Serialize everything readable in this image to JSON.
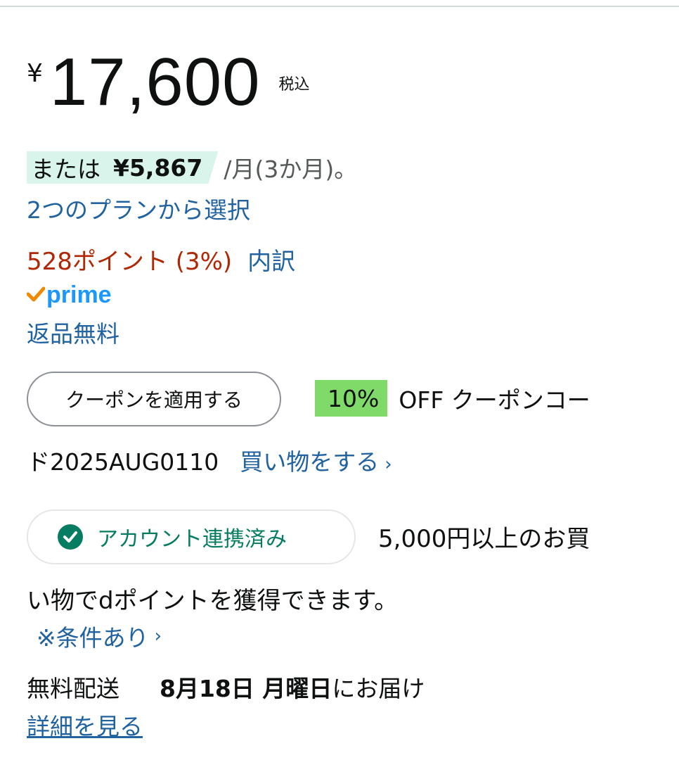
{
  "price": {
    "currency": "¥",
    "amount": "17,600",
    "tax_label": "税込"
  },
  "installment": {
    "prefix": "または",
    "amount": "¥5,867",
    "suffix": "/月(3か月)。",
    "highlight_color": "#d9f4ea"
  },
  "plan_link": "2つのプランから選択",
  "points": {
    "text": "528ポイント (3%)",
    "breakdown_link": "内訳"
  },
  "prime": {
    "label": "prime",
    "check_color": "#f08804",
    "label_color": "#1a98ff"
  },
  "returns_link": "返品無料",
  "coupon": {
    "button_label": "クーポンを適用する",
    "badge": "10%",
    "line1": "OFF クーポンコー",
    "line2": "ド2025AUG0110",
    "shop_link": "買い物をする",
    "badge_color": "#7fda69"
  },
  "account": {
    "badge_label": "アカウント連携済み",
    "text_line1": "5,000円以上のお買",
    "text_line2": "い物でdポイントを獲得できます。",
    "conditions_link": "※条件あり"
  },
  "delivery": {
    "prefix": "無料配送",
    "date": "8月18日 月曜日",
    "suffix": "にお届け",
    "details_link": "詳細を見る"
  },
  "colors": {
    "link": "#2162a1",
    "points": "#b12704",
    "account_green": "#067d62"
  }
}
